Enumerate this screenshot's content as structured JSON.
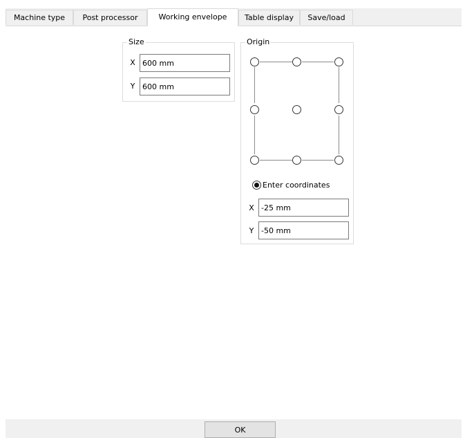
{
  "tabs": [
    {
      "label": "Machine type",
      "active": false
    },
    {
      "label": "Post processor",
      "active": false
    },
    {
      "label": "Working envelope",
      "active": true
    },
    {
      "label": "Table display",
      "active": false
    },
    {
      "label": "Save/load",
      "active": false
    }
  ],
  "size_group": {
    "legend": "Size",
    "x_label": "X",
    "x_value": "600 mm",
    "y_label": "Y",
    "y_value": "600 mm"
  },
  "origin_group": {
    "legend": "Origin",
    "selected_option": "enter-coordinates",
    "enter_coordinates_label": "Enter coordinates",
    "x_label": "X",
    "x_value": "-25 mm",
    "y_label": "Y",
    "y_value": "-50 mm"
  },
  "footer": {
    "ok_label": "OK"
  }
}
